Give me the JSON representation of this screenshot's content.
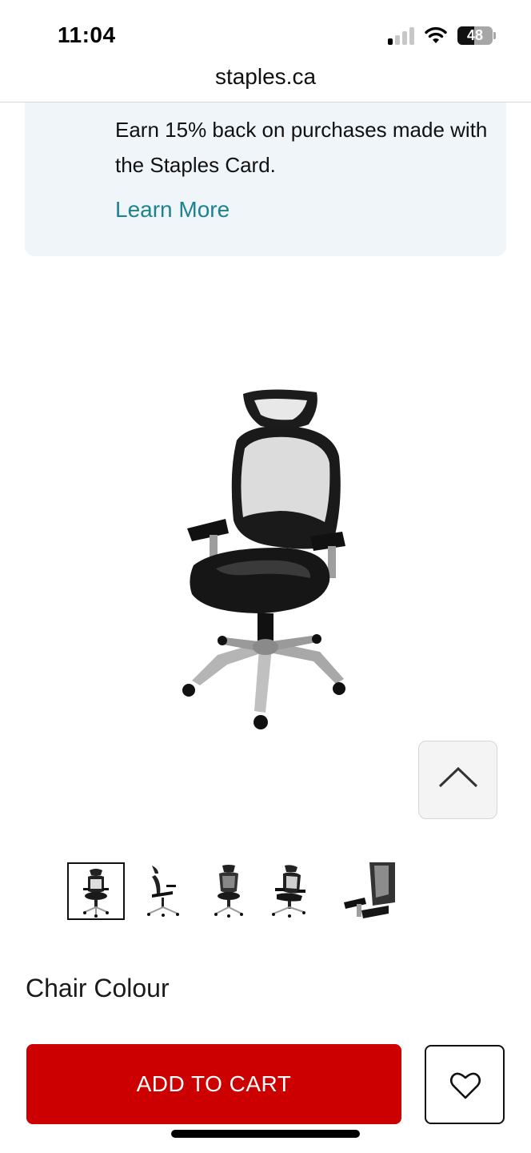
{
  "status_bar": {
    "time": "11:04",
    "battery_level": "48",
    "signal_bars_active": 1,
    "icons": [
      "signal-icon",
      "wifi-icon",
      "battery-icon"
    ]
  },
  "browser": {
    "url": "staples.ca"
  },
  "promo": {
    "text": "Earn 15% back on purchases made with the Staples Card.",
    "link_label": "Learn More",
    "background_color": "#eff5f9",
    "link_color": "#1e8290"
  },
  "product": {
    "main_image": "office-chair-image",
    "thumbnails": [
      {
        "name": "chair-front-thumbnail",
        "selected": true
      },
      {
        "name": "chair-side-thumbnail",
        "selected": false
      },
      {
        "name": "chair-back-thumbnail",
        "selected": false
      },
      {
        "name": "chair-angle-thumbnail",
        "selected": false
      },
      {
        "name": "chair-armrest-detail-thumbnail",
        "selected": false
      }
    ],
    "colour_label": "Chair Colour"
  },
  "actions": {
    "add_to_cart_label": "ADD TO CART",
    "add_to_cart_color": "#cc0000",
    "wishlist_icon": "heart-icon",
    "scroll_top_icon": "chevron-up-icon"
  }
}
